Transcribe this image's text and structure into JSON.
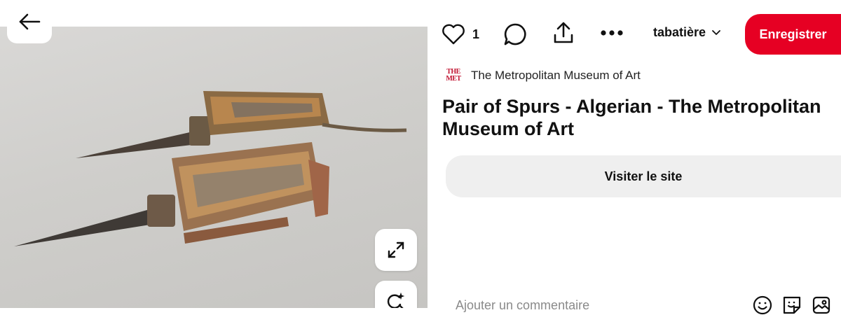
{
  "pin": {
    "image_alt": "Pair of Spurs",
    "title": "Pair of Spurs - Algerian - The Metropolitan Museum of Art",
    "source": {
      "logo_text_line1": "THE",
      "logo_text_line2": "MET",
      "name": "The Metropolitan Museum of Art"
    }
  },
  "actions": {
    "like_count": "1",
    "board_name": "tabatière",
    "save_label": "Enregistrer"
  },
  "visit": {
    "label": "Visiter le site"
  },
  "comment": {
    "placeholder": "Ajouter un commentaire"
  },
  "icons": {
    "back": "arrow-left-icon",
    "expand": "expand-icon",
    "visual_search": "visual-search-icon",
    "like": "heart-icon",
    "comment": "comment-bubble-icon",
    "share": "share-upload-icon",
    "more": "more-horizontal-icon",
    "board_chevron": "chevron-down-icon",
    "emoji": "emoji-icon",
    "sticker": "sticker-icon",
    "photo": "image-icon"
  },
  "colors": {
    "brand_red": "#e60023",
    "met_red": "#c0102e",
    "visit_bg": "#efefef"
  }
}
